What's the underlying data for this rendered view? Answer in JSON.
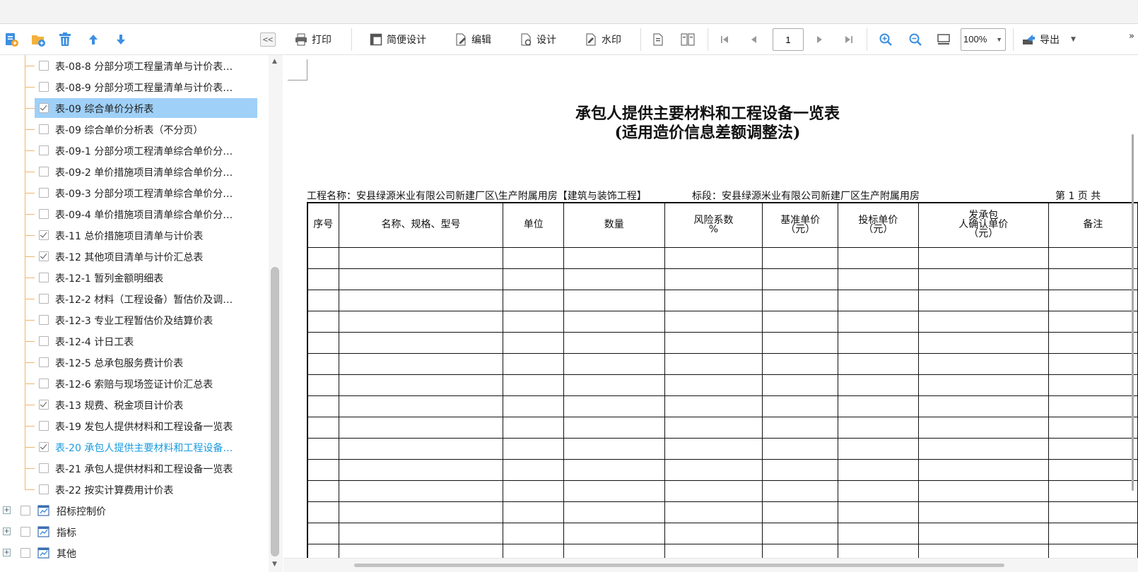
{
  "left_toolbar": {
    "icons": [
      "add-report-icon",
      "add-folder-icon",
      "delete-icon",
      "move-up-icon",
      "move-down-icon"
    ],
    "collapse_label": "<<"
  },
  "tree": {
    "items": [
      {
        "label": "表-08-8 分部分项工程量清单与计价表…",
        "checked": false
      },
      {
        "label": "表-08-9 分部分项工程量清单与计价表…",
        "checked": false
      },
      {
        "label": "表-09 综合单价分析表",
        "checked": true,
        "selected": true
      },
      {
        "label": "表-09 综合单价分析表（不分页）",
        "checked": false
      },
      {
        "label": "表-09-1 分部分项工程清单综合单价分…",
        "checked": false
      },
      {
        "label": "表-09-2 单价措施项目清单综合单价分…",
        "checked": false
      },
      {
        "label": "表-09-3 分部分项工程清单综合单价分…",
        "checked": false
      },
      {
        "label": "表-09-4 单价措施项目清单综合单价分…",
        "checked": false
      },
      {
        "label": "表-11 总价措施项目清单与计价表",
        "checked": true
      },
      {
        "label": "表-12 其他项目清单与计价汇总表",
        "checked": true
      },
      {
        "label": "表-12-1 暂列金额明细表",
        "checked": false
      },
      {
        "label": "表-12-2 材料（工程设备）暂估价及调…",
        "checked": false
      },
      {
        "label": "表-12-3 专业工程暂估价及结算价表",
        "checked": false
      },
      {
        "label": "表-12-4 计日工表",
        "checked": false
      },
      {
        "label": "表-12-5 总承包服务费计价表",
        "checked": false
      },
      {
        "label": "表-12-6 索赔与现场签证计价汇总表",
        "checked": false
      },
      {
        "label": "表-13 规费、税金项目计价表",
        "checked": true
      },
      {
        "label": "表-19 发包人提供材料和工程设备一览表",
        "checked": false
      },
      {
        "label": "表-20 承包人提供主要材料和工程设备…",
        "checked": true,
        "highlight": true
      },
      {
        "label": "表-21 承包人提供材料和工程设备一览表",
        "checked": false
      },
      {
        "label": "表-22 按实计算费用计价表",
        "checked": false
      }
    ],
    "parents": [
      {
        "label": "招标控制价",
        "expander": "+"
      },
      {
        "label": "指标",
        "expander": "+"
      },
      {
        "label": "其他",
        "expander": "+"
      }
    ]
  },
  "toolbar": {
    "print": "打印",
    "simple_design": "简便设计",
    "edit": "编辑",
    "design": "设计",
    "watermark": "水印",
    "page": "1",
    "zoom": "100%",
    "export": "导出",
    "more": "»"
  },
  "report": {
    "title_line1": "承包人提供主要材料和工程设备一览表",
    "title_line2": "(适用造价信息差额调整法)",
    "project": "工程名称：安县绿源米业有限公司新建厂区\\生产附属用房【建筑与装饰工程】",
    "section": "标段：安县绿源米业有限公司新建厂区生产附属用房",
    "page_info": "第  1  页  共",
    "columns": [
      {
        "l1": "序号",
        "l2": "",
        "l3": ""
      },
      {
        "l1": "名称、规格、型号",
        "l2": "",
        "l3": ""
      },
      {
        "l1": "单位",
        "l2": "",
        "l3": ""
      },
      {
        "l1": "数量",
        "l2": "",
        "l3": ""
      },
      {
        "l1": "风险系数",
        "l2": "%",
        "l3": ""
      },
      {
        "l1": "基准单价",
        "l2": "（元）",
        "l3": ""
      },
      {
        "l1": "投标单价",
        "l2": "（元）",
        "l3": ""
      },
      {
        "l1": "发承包",
        "l2": "人确认单价",
        "l3": "（元）"
      },
      {
        "l1": "备注",
        "l2": "",
        "l3": ""
      }
    ]
  }
}
